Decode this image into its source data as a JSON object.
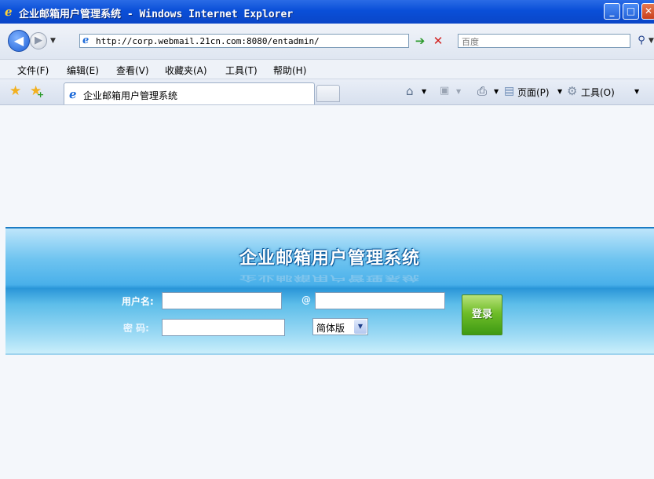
{
  "window": {
    "title": "企业邮箱用户管理系统 - Windows Internet Explorer"
  },
  "address_bar": {
    "url": "http://corp.webmail.21cn.com:8080/entadmin/",
    "search_placeholder": "百度"
  },
  "menu": [
    "文件(F)",
    "编辑(E)",
    "查看(V)",
    "收藏夹(A)",
    "工具(T)",
    "帮助(H)"
  ],
  "tab": {
    "label": "企业邮箱用户管理系统"
  },
  "commands": {
    "page_label": "页面(P)",
    "tools_label": "工具(O)"
  },
  "login": {
    "system_title": "企业邮箱用户管理系统",
    "username_label": "用户名:",
    "at_symbol": "@",
    "password_label": "密  码:",
    "language_selected": "简体版",
    "login_button": "登录"
  },
  "colors": {
    "titlebar": "#0a4fd8",
    "banner": "#49b0ea",
    "login_button": "#6fbd29"
  }
}
